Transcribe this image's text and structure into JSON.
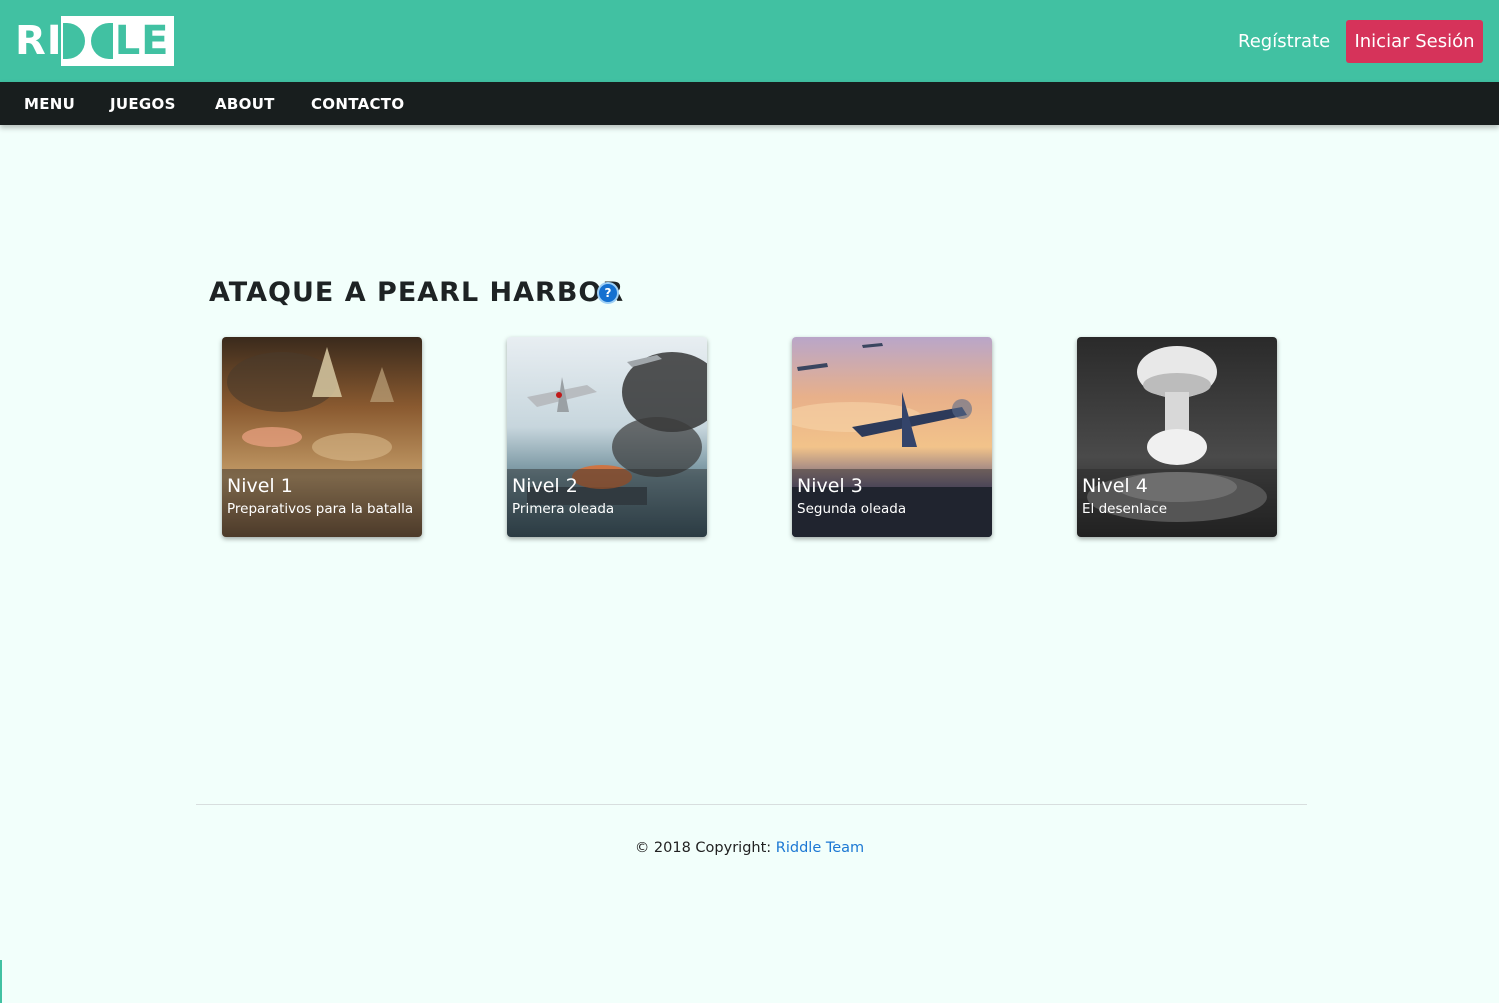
{
  "header": {
    "logo_text_left": "RI",
    "logo_text_right": "LE",
    "register_label": "Regístrate",
    "login_label": "Iniciar Sesión"
  },
  "nav": {
    "items": [
      "MENU",
      "JUEGOS",
      "ABOUT",
      "CONTACTO"
    ]
  },
  "main": {
    "title": "ATAQUE A PEARL HARBOR",
    "help_glyph": "?",
    "cards": [
      {
        "title": "Nivel 1",
        "subtitle": "Preparativos para la batalla"
      },
      {
        "title": "Nivel 2",
        "subtitle": "Primera oleada"
      },
      {
        "title": "Nivel 3",
        "subtitle": "Segunda oleada"
      },
      {
        "title": "Nivel 4",
        "subtitle": "El desenlace"
      }
    ]
  },
  "footer": {
    "copyright": "© 2018 Copyright: ",
    "team_link": "Riddle Team"
  },
  "colors": {
    "header_bg": "#41c1a2",
    "nav_bg": "#181e1e",
    "login_button": "#d6335a",
    "page_bg": "#f2fffb",
    "link": "#1c78d4"
  },
  "icons": {
    "help": "question-circle-icon"
  }
}
